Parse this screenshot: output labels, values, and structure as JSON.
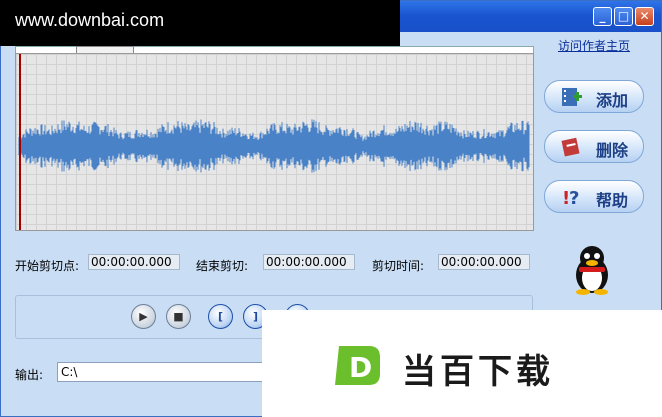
{
  "watermark": {
    "site": "www.downbai.com"
  },
  "window": {
    "minimize": "_",
    "maximize": "□",
    "close": "✕"
  },
  "author_link": "访问作者主页",
  "buttons": {
    "add": {
      "label": "添加",
      "icon": "add-film-icon"
    },
    "delete": {
      "label": "删除",
      "icon": "delete-film-icon"
    },
    "help": {
      "label": "帮助",
      "icon": "help-icon"
    }
  },
  "mascot": {
    "icon": "qq-penguin-icon"
  },
  "cut": {
    "start_label": "开始剪切点:",
    "start_value": "00:00:00.000",
    "end_label": "结束剪切:",
    "end_value": "00:00:00.000",
    "duration_label": "剪切时间:",
    "duration_value": "00:00:00.000"
  },
  "player": {
    "play": "▶",
    "stop": "■",
    "mark_in": "[",
    "mark_out": "]"
  },
  "output": {
    "label": "输出:",
    "value": "C:\\"
  },
  "promo": {
    "logo_letter": "D",
    "text": "当百下载"
  },
  "colors": {
    "waveform": "#4a82c8",
    "accent": "#2160d8",
    "promo_green": "#6cbf2c"
  }
}
